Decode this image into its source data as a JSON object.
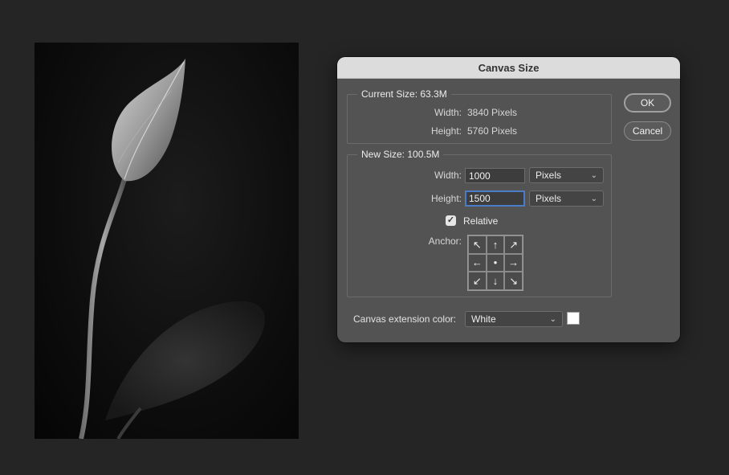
{
  "dialog": {
    "title": "Canvas Size",
    "current_size": {
      "legend": "Current Size: 63.3M",
      "width_label": "Width:",
      "width_value": "3840 Pixels",
      "height_label": "Height:",
      "height_value": "5760 Pixels"
    },
    "new_size": {
      "legend": "New Size: 100.5M",
      "width_label": "Width:",
      "width_value": "1000",
      "width_unit": "Pixels",
      "height_label": "Height:",
      "height_value": "1500",
      "height_unit": "Pixels",
      "relative_label": "Relative",
      "relative_checked": true,
      "anchor_label": "Anchor:",
      "anchor_arrows": [
        "↖",
        "↑",
        "↗",
        "←",
        "●",
        "→",
        "↙",
        "↓",
        "↘"
      ]
    },
    "extension_color": {
      "label": "Canvas extension color:",
      "value": "White",
      "swatch_color": "#ffffff"
    },
    "buttons": {
      "ok": "OK",
      "cancel": "Cancel"
    }
  },
  "colors": {
    "background": "#252525",
    "dialog_bg": "#535353",
    "focus_accent": "#4a7cc7"
  }
}
